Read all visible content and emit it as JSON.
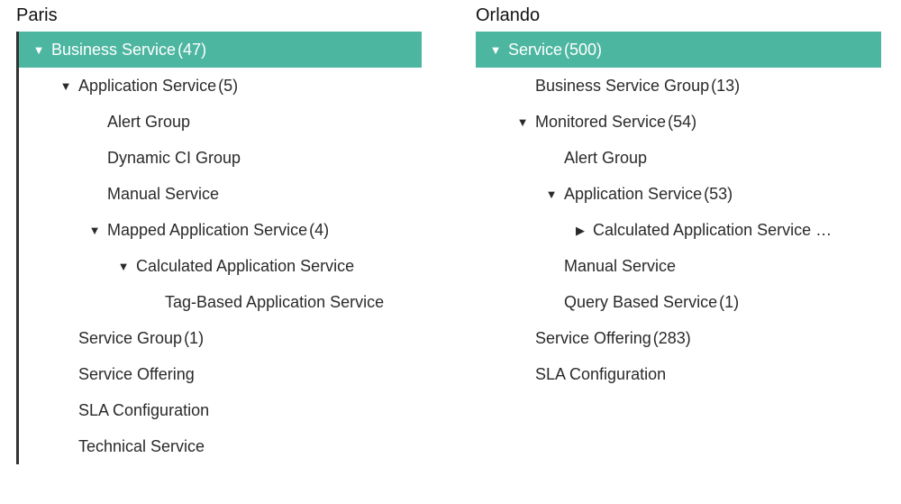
{
  "columns": [
    {
      "title": "Paris",
      "border": true,
      "nodes": [
        {
          "indent": 0,
          "caret": "down",
          "label": "Business Service",
          "count": 47,
          "highlight": true,
          "interactable": true,
          "name": "node-business-service"
        },
        {
          "indent": 1,
          "caret": "down",
          "label": "Application Service",
          "count": 5,
          "highlight": false,
          "interactable": true,
          "name": "node-application-service"
        },
        {
          "indent": 2,
          "caret": "none",
          "label": "Alert Group",
          "highlight": false,
          "interactable": true,
          "name": "node-alert-group"
        },
        {
          "indent": 2,
          "caret": "none",
          "label": "Dynamic CI Group",
          "highlight": false,
          "interactable": true,
          "name": "node-dynamic-ci-group"
        },
        {
          "indent": 2,
          "caret": "none",
          "label": "Manual Service",
          "highlight": false,
          "interactable": true,
          "name": "node-manual-service"
        },
        {
          "indent": 2,
          "caret": "down",
          "label": "Mapped Application Service",
          "count": 4,
          "highlight": false,
          "interactable": true,
          "name": "node-mapped-application-service"
        },
        {
          "indent": 3,
          "caret": "down",
          "label": "Calculated Application Service",
          "highlight": false,
          "interactable": true,
          "name": "node-calculated-application-service"
        },
        {
          "indent": 4,
          "caret": "none",
          "label": "Tag-Based Application Service",
          "highlight": false,
          "interactable": true,
          "name": "node-tag-based-application-service"
        },
        {
          "indent": 1,
          "caret": "none",
          "label": "Service Group",
          "count": 1,
          "highlight": false,
          "interactable": true,
          "name": "node-service-group"
        },
        {
          "indent": 1,
          "caret": "none",
          "label": "Service Offering",
          "highlight": false,
          "interactable": true,
          "name": "node-service-offering"
        },
        {
          "indent": 1,
          "caret": "none",
          "label": "SLA Configuration",
          "highlight": false,
          "interactable": true,
          "name": "node-sla-configuration"
        },
        {
          "indent": 1,
          "caret": "none",
          "label": "Technical Service",
          "highlight": false,
          "interactable": true,
          "name": "node-technical-service"
        }
      ]
    },
    {
      "title": "Orlando",
      "border": false,
      "nodes": [
        {
          "indent": 0,
          "caret": "down",
          "label": "Service",
          "count": 500,
          "highlight": true,
          "interactable": true,
          "name": "node-service"
        },
        {
          "indent": 1,
          "caret": "none",
          "label": "Business Service Group",
          "count": 13,
          "highlight": false,
          "interactable": true,
          "name": "node-business-service-group"
        },
        {
          "indent": 1,
          "caret": "down",
          "label": "Monitored Service",
          "count": 54,
          "highlight": false,
          "interactable": true,
          "name": "node-monitored-service"
        },
        {
          "indent": 2,
          "caret": "none",
          "label": "Alert Group",
          "highlight": false,
          "interactable": true,
          "name": "node-alert-group-o"
        },
        {
          "indent": 2,
          "caret": "down",
          "label": "Application Service",
          "count": 53,
          "highlight": false,
          "interactable": true,
          "name": "node-application-service-o"
        },
        {
          "indent": 3,
          "caret": "right",
          "label": "Calculated Application Service …",
          "highlight": false,
          "interactable": true,
          "name": "node-calculated-application-service-o"
        },
        {
          "indent": 2,
          "caret": "none",
          "label": "Manual Service",
          "highlight": false,
          "interactable": true,
          "name": "node-manual-service-o"
        },
        {
          "indent": 2,
          "caret": "none",
          "label": "Query Based Service",
          "count": 1,
          "highlight": false,
          "interactable": true,
          "name": "node-query-based-service"
        },
        {
          "indent": 1,
          "caret": "none",
          "label": "Service Offering",
          "count": 283,
          "highlight": false,
          "interactable": true,
          "name": "node-service-offering-o"
        },
        {
          "indent": 1,
          "caret": "none",
          "label": "SLA Configuration",
          "highlight": false,
          "interactable": true,
          "name": "node-sla-configuration-o"
        }
      ]
    }
  ]
}
